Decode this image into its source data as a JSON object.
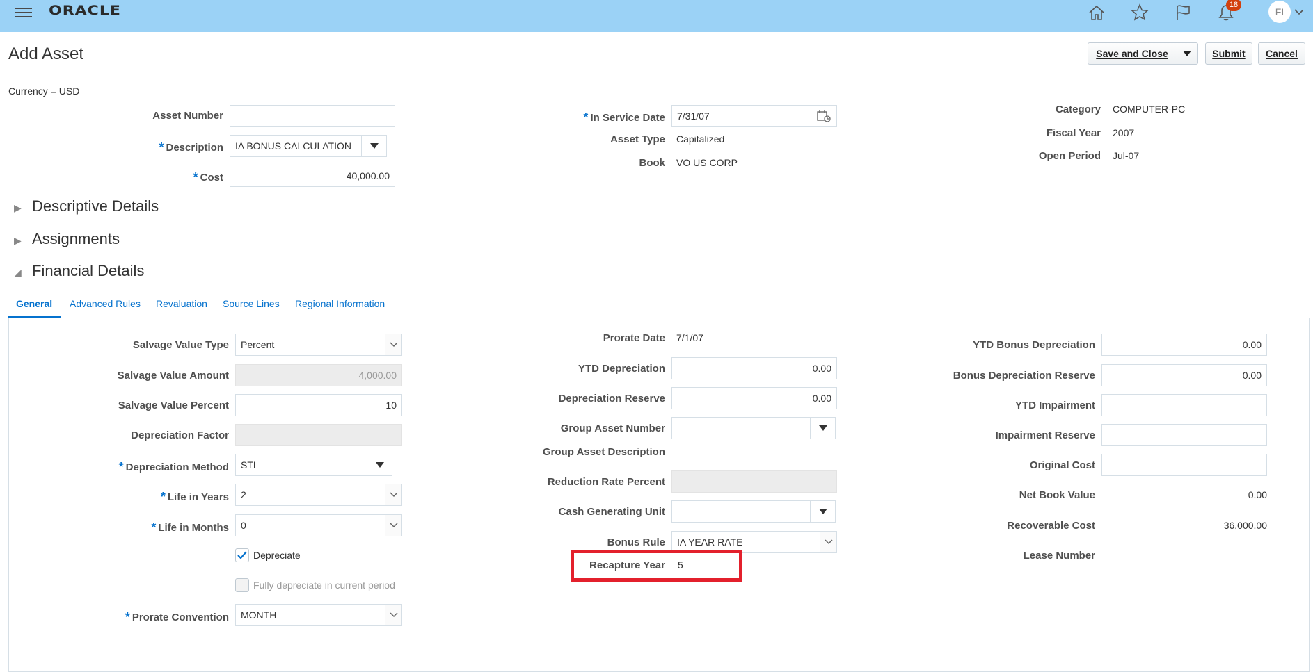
{
  "brand": "ORACLE",
  "notifications_count": "18",
  "user_initials": "FI",
  "page": {
    "title": "Add Asset",
    "currency": "Currency = USD",
    "buttons": {
      "save_close": "Save and Close",
      "submit": "Submit",
      "cancel": "Cancel"
    }
  },
  "header_fields": {
    "asset_number": {
      "label": "Asset Number",
      "value": ""
    },
    "description": {
      "label": "Description",
      "value": "IA BONUS CALCULATION"
    },
    "cost": {
      "label": "Cost",
      "value": "40,000.00"
    },
    "in_service_date": {
      "label": "In Service Date",
      "value": "7/31/07"
    },
    "asset_type": {
      "label": "Asset Type",
      "value": "Capitalized"
    },
    "book": {
      "label": "Book",
      "value": "VO US CORP"
    },
    "category": {
      "label": "Category",
      "value": "COMPUTER-PC"
    },
    "fiscal_year": {
      "label": "Fiscal Year",
      "value": "2007"
    },
    "open_period": {
      "label": "Open Period",
      "value": "Jul-07"
    }
  },
  "sections": {
    "descriptive": "Descriptive Details",
    "assignments": "Assignments",
    "financial": "Financial Details"
  },
  "tabs": [
    "General",
    "Advanced Rules",
    "Revaluation",
    "Source Lines",
    "Regional Information"
  ],
  "general": {
    "col1": {
      "salvage_value_type": {
        "label": "Salvage Value Type",
        "value": "Percent"
      },
      "salvage_value_amount": {
        "label": "Salvage Value Amount",
        "value": "4,000.00"
      },
      "salvage_value_percent": {
        "label": "Salvage Value Percent",
        "value": "10"
      },
      "depreciation_factor": {
        "label": "Depreciation Factor",
        "value": ""
      },
      "depreciation_method": {
        "label": "Depreciation Method",
        "value": "STL"
      },
      "life_in_years": {
        "label": "Life in Years",
        "value": "2"
      },
      "life_in_months": {
        "label": "Life in Months",
        "value": "0"
      },
      "depreciate": {
        "label": "Depreciate",
        "checked": true
      },
      "fully_depreciate": {
        "label": "Fully depreciate in current period",
        "checked": false
      },
      "prorate_convention": {
        "label": "Prorate Convention",
        "value": "MONTH"
      }
    },
    "col2": {
      "prorate_date": {
        "label": "Prorate Date",
        "value": "7/1/07"
      },
      "ytd_depreciation": {
        "label": "YTD Depreciation",
        "value": "0.00"
      },
      "depreciation_reserve": {
        "label": "Depreciation Reserve",
        "value": "0.00"
      },
      "group_asset_number": {
        "label": "Group Asset Number",
        "value": ""
      },
      "group_asset_description": {
        "label": "Group Asset Description",
        "value": ""
      },
      "reduction_rate_percent": {
        "label": "Reduction Rate Percent",
        "value": ""
      },
      "cash_generating_unit": {
        "label": "Cash Generating Unit",
        "value": ""
      },
      "bonus_rule": {
        "label": "Bonus Rule",
        "value": "IA YEAR RATE"
      },
      "recapture_year": {
        "label": "Recapture Year",
        "value": "5"
      }
    },
    "col3": {
      "ytd_bonus_depreciation": {
        "label": "YTD Bonus Depreciation",
        "value": "0.00"
      },
      "bonus_depreciation_reserve": {
        "label": "Bonus Depreciation Reserve",
        "value": "0.00"
      },
      "ytd_impairment": {
        "label": "YTD Impairment",
        "value": ""
      },
      "impairment_reserve": {
        "label": "Impairment Reserve",
        "value": ""
      },
      "original_cost": {
        "label": "Original Cost",
        "value": ""
      },
      "net_book_value": {
        "label": "Net Book Value",
        "value": "0.00"
      },
      "recoverable_cost": {
        "label": "Recoverable Cost",
        "value": "36,000.00"
      },
      "lease_number": {
        "label": "Lease Number",
        "value": ""
      }
    }
  },
  "colors": {
    "topbar": "#9bd2f6",
    "accent": "#0572ce",
    "highlight": "#e3202c",
    "required": "#0572ce"
  }
}
